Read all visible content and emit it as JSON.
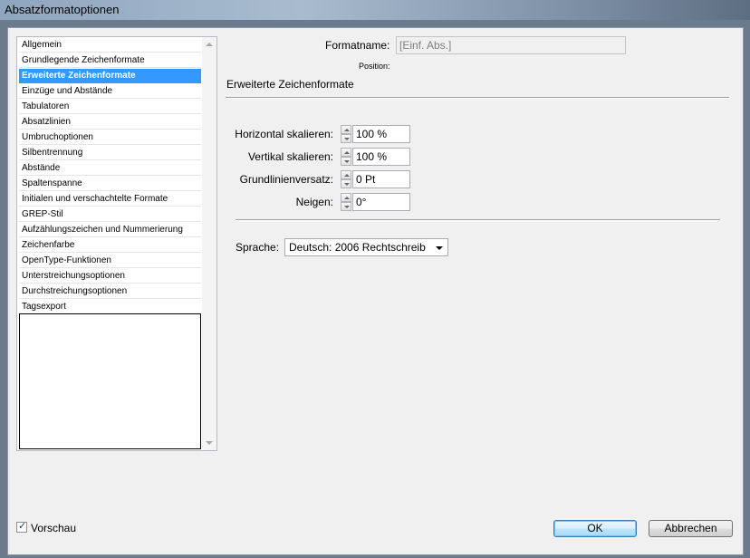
{
  "window": {
    "title": "Absatzformatoptionen"
  },
  "sidebar": {
    "items": [
      {
        "label": "Allgemein"
      },
      {
        "label": "Grundlegende Zeichenformate"
      },
      {
        "label": "Erweiterte Zeichenformate",
        "selected": true
      },
      {
        "label": "Einzüge und Abstände"
      },
      {
        "label": "Tabulatoren"
      },
      {
        "label": "Absatzlinien"
      },
      {
        "label": "Umbruchoptionen"
      },
      {
        "label": "Silbentrennung"
      },
      {
        "label": "Abstände"
      },
      {
        "label": "Spaltenspanne"
      },
      {
        "label": "Initialen und verschachtelte Formate"
      },
      {
        "label": "GREP-Stil"
      },
      {
        "label": "Aufzählungszeichen und Nummerierung"
      },
      {
        "label": "Zeichenfarbe"
      },
      {
        "label": "OpenType-Funktionen"
      },
      {
        "label": "Unterstreichungsoptionen"
      },
      {
        "label": "Durchstreichungsoptionen"
      },
      {
        "label": "Tagsexport"
      }
    ]
  },
  "header": {
    "format_name_label": "Formatname:",
    "format_name_value": "[Einf. Abs.]",
    "position_label": "Position:",
    "section_title": "Erweiterte Zeichenformate"
  },
  "fields": {
    "horizontal": {
      "label": "Horizontal skalieren:",
      "value": "100 %"
    },
    "vertical": {
      "label": "Vertikal skalieren:",
      "value": "100 %"
    },
    "baseline": {
      "label": "Grundlinienversatz:",
      "value": "0 Pt"
    },
    "skew": {
      "label": "Neigen:",
      "value": "0°"
    }
  },
  "language": {
    "label": "Sprache:",
    "value": "Deutsch: 2006 Rechtschreib"
  },
  "footer": {
    "preview_label": "Vorschau",
    "preview_checked": true,
    "ok_label": "OK",
    "cancel_label": "Abbrechen"
  },
  "colors": {
    "selection": "#3399ff",
    "default_button_border": "#3c7fb1"
  }
}
